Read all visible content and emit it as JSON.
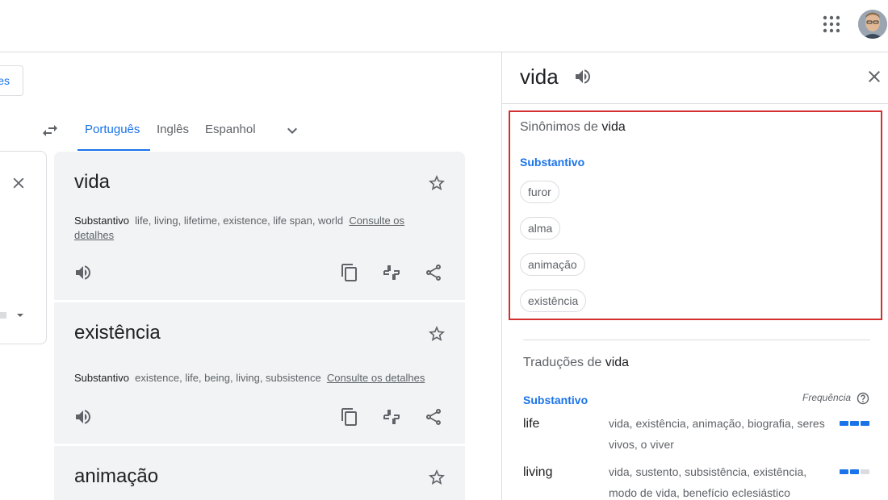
{
  "partial_button": {
    "label": "es"
  },
  "language_tabs": [
    {
      "label": "Português",
      "active": true
    },
    {
      "label": "Inglês",
      "active": false
    },
    {
      "label": "Espanhol",
      "active": false
    }
  ],
  "cards": [
    {
      "word": "vida",
      "pos": "Substantivo",
      "translations": "life, living, lifetime, existence, life span, world",
      "link": "Consulte os detalhes"
    },
    {
      "word": "existência",
      "pos": "Substantivo",
      "translations": "existence, life, being, living, subsistence",
      "link": "Consulte os detalhes"
    },
    {
      "word": "animação"
    }
  ],
  "panel": {
    "word": "vida",
    "synonyms": {
      "title_prefix": "Sinônimos de",
      "title_word": "vida",
      "pos": "Substantivo",
      "chips": [
        "furor",
        "alma",
        "animação",
        "existência"
      ]
    },
    "translations": {
      "title_prefix": "Traduções de",
      "title_word": "vida",
      "pos": "Substantivo",
      "frequency_label": "Frequência",
      "rows": [
        {
          "word": "life",
          "synonyms": "vida, existência, animação, biografia, seres vivos, o viver",
          "frequency": 3
        },
        {
          "word": "living",
          "synonyms": "vida, sustento, subsistência, existência, modo de vida, benefício eclesiástico",
          "frequency": 2
        }
      ]
    }
  },
  "colors": {
    "accent": "#1a73e8",
    "highlight_border": "#d32f2f",
    "card_bg": "#f1f3f4"
  },
  "icons": [
    "apps-grid-icon",
    "avatar",
    "swap-languages-icon",
    "chevron-down-icon",
    "clear-icon",
    "star-icon",
    "speaker-icon",
    "copy-icon",
    "rate-translation-icon",
    "share-icon",
    "close-icon",
    "help-icon"
  ]
}
